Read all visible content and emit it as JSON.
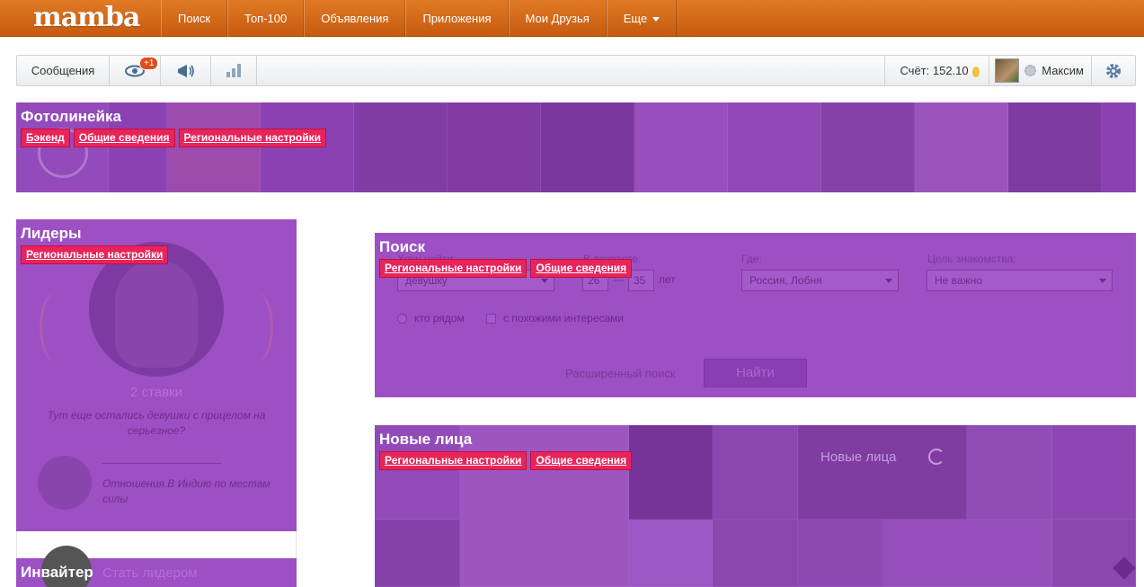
{
  "topnav": {
    "logo": "mamba",
    "items": [
      "Поиск",
      "Топ-100",
      "Объявления",
      "Приложения",
      "Мои Друзья",
      "Еще"
    ]
  },
  "toolbar": {
    "messages": "Сообщения",
    "views_badge": "+1",
    "score": "Счёт: 152.10",
    "user_name": "Максим"
  },
  "photoline": {
    "title": "Фотолинейка",
    "tags": [
      "Бэкенд",
      "Общие сведения",
      "Региональные настройки"
    ]
  },
  "leaders": {
    "title": "Лидеры",
    "tags": [
      "Региональные настройки"
    ],
    "stakes": "2 ставки",
    "prompt": "Тут еще остались девушки с прицелом на серьезное?",
    "note": "Отношения.В Индию по местам силы"
  },
  "inviter": {
    "title": "Инвайтер",
    "become_leader": "Стать лидером"
  },
  "search": {
    "title": "Поиск",
    "tags": [
      "Региональные настройки",
      "Общие сведения"
    ],
    "want_label": "Хочу найти:",
    "want_value": "девушку",
    "age_label": "В возрасте:",
    "age_from": "26",
    "age_to": "35",
    "age_dash": "—",
    "age_unit": "лет",
    "where_label": "Где:",
    "where_value": "Россия, Лобня",
    "goal_label": "Цель знакомства:",
    "goal_value": "Не важно",
    "check_nearby": "кто рядом",
    "check_interests": "с похожими интересами",
    "advanced": "Расширенный поиск",
    "find_button": "Найти"
  },
  "newfaces": {
    "title": "Новые лица",
    "tags": [
      "Региональные настройки",
      "Общие сведения"
    ],
    "inner_label": "Новые лица"
  },
  "colors": {
    "brand_orange": "#d96b1c",
    "overlay_purple": "#9d4fc4",
    "tag_pink": "#e8245a"
  }
}
